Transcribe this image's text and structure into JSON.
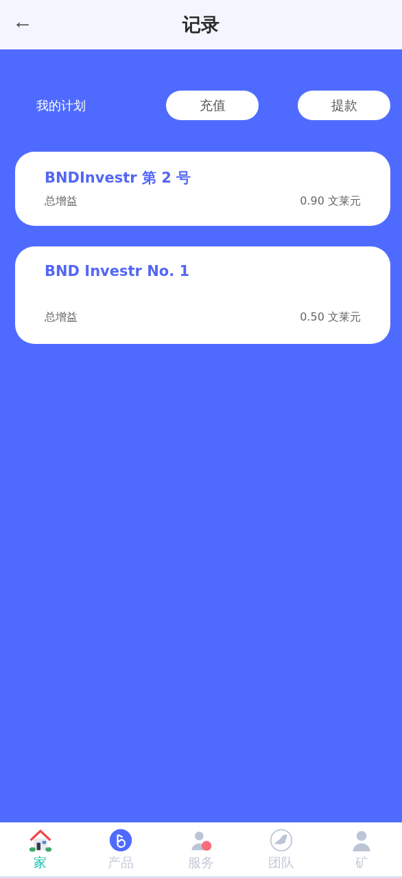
{
  "header": {
    "back": "←",
    "title": "记录"
  },
  "actions": {
    "label": "我的计划",
    "buttons": [
      "充值",
      "提款"
    ]
  },
  "plans": [
    {
      "name": "BNDInvestr 第 2 号",
      "metric": "总增益",
      "value": "0.90 文莱元"
    },
    {
      "name": "BND Investr No. 1",
      "metric": "总增益",
      "value": "0.50 文莱元"
    }
  ],
  "tabbar": [
    {
      "kind": "house",
      "label": "家",
      "selected": true
    },
    {
      "kind": "coin",
      "label": "产品",
      "selected": false
    },
    {
      "kind": "service",
      "label": "服务",
      "selected": false
    },
    {
      "kind": "bird",
      "label": "团队",
      "selected": false
    },
    {
      "kind": "person",
      "label": "矿",
      "selected": false
    }
  ]
}
